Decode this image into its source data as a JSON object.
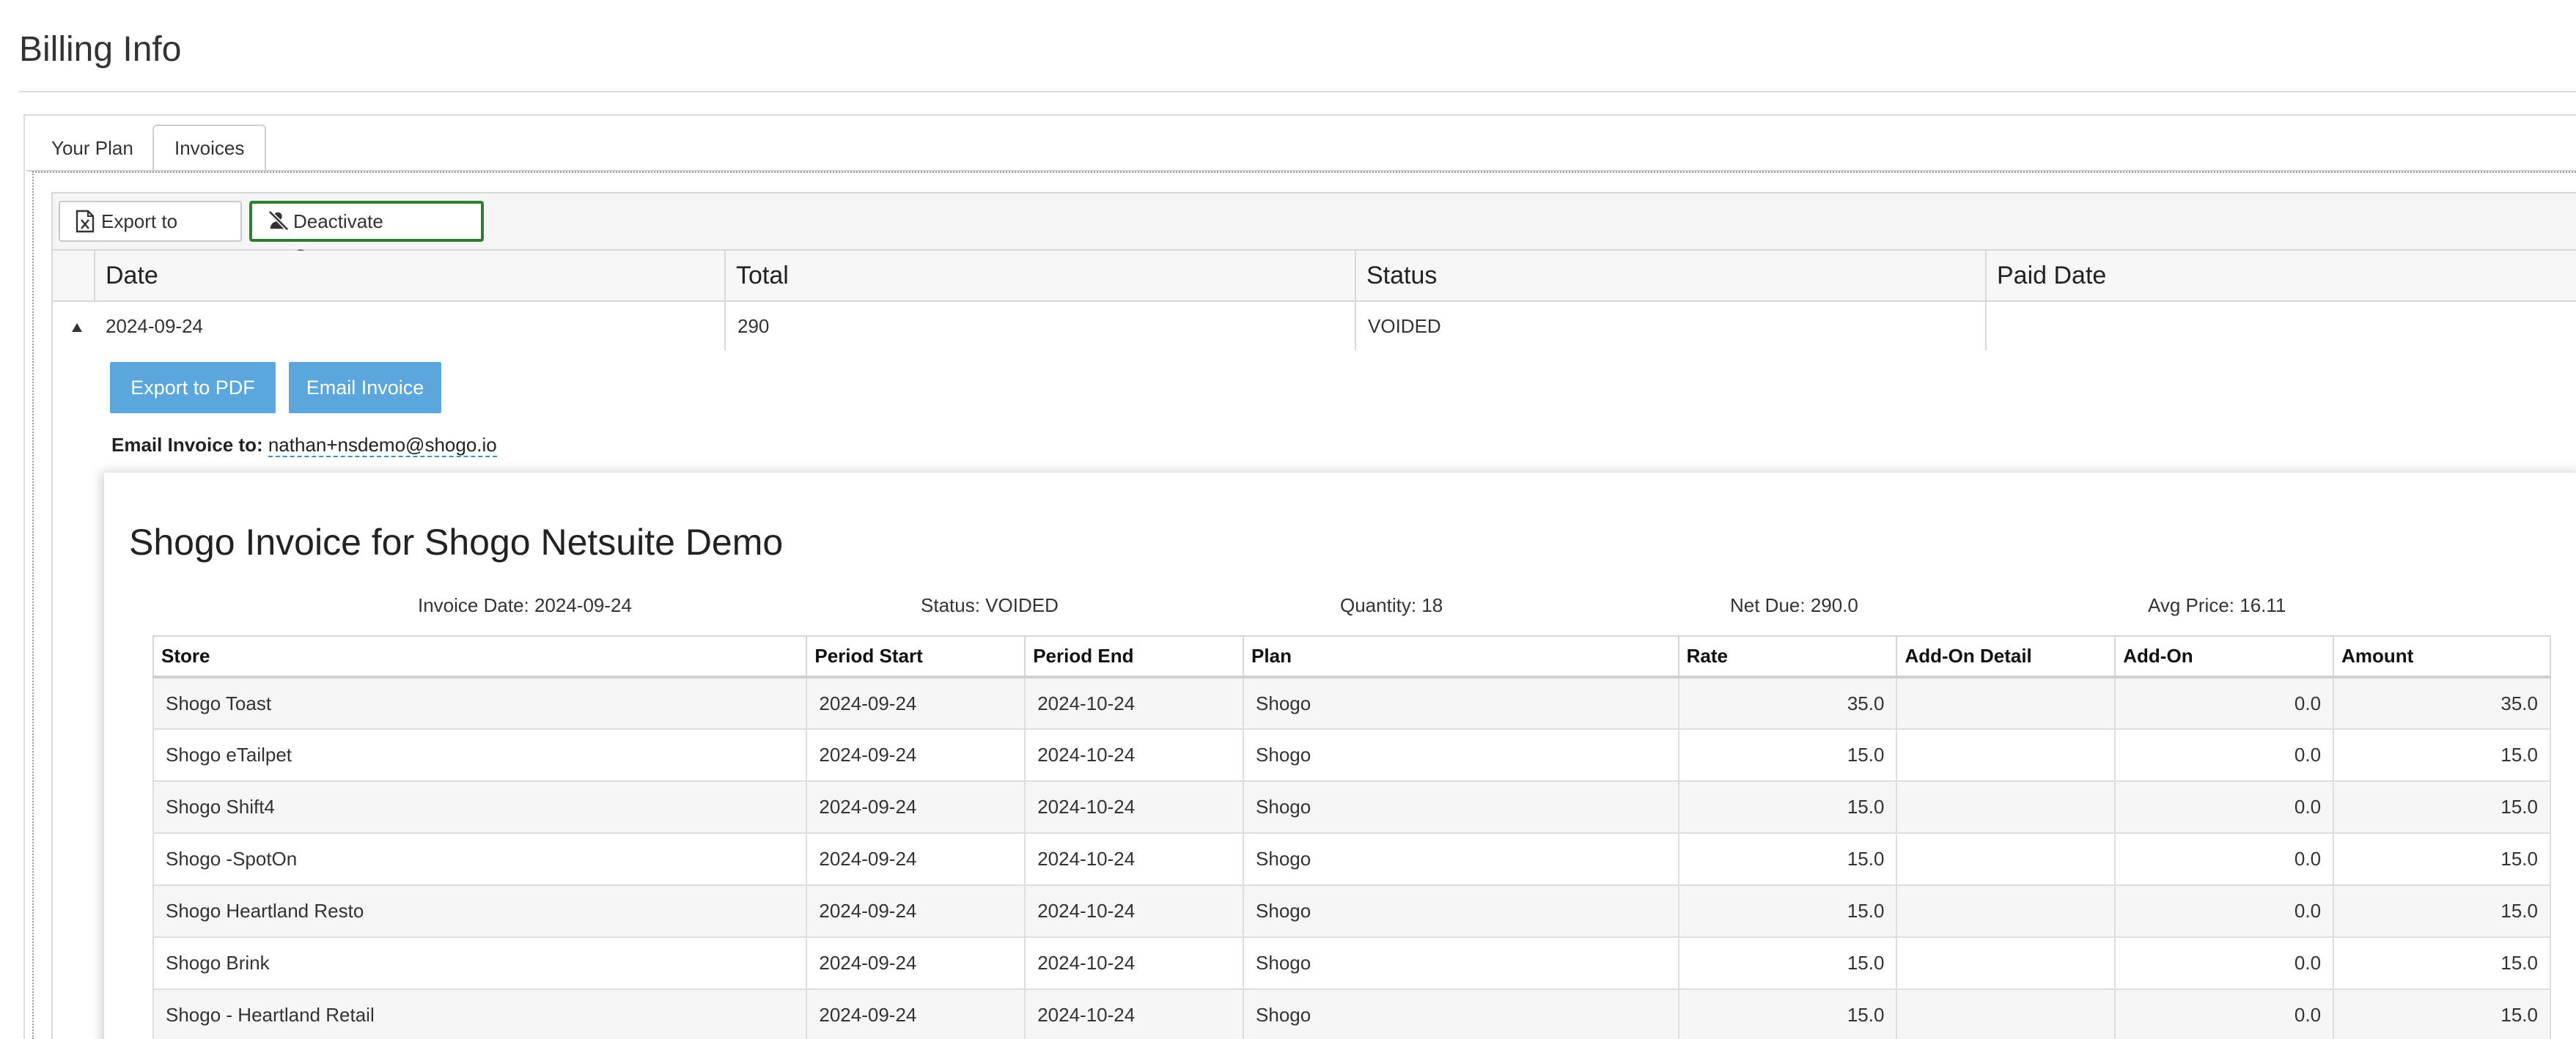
{
  "page": {
    "title": "Billing Info"
  },
  "tabs": [
    {
      "label": "Your Plan"
    },
    {
      "label": "Invoices"
    }
  ],
  "toolbar": {
    "export_excel_label": "Export to Excel",
    "deactivate_label": "Deactivate Customer"
  },
  "grid": {
    "columns": [
      "Date",
      "Total",
      "Status",
      "Paid Date"
    ],
    "row": {
      "date": "2024-09-24",
      "total": "290",
      "status": "VOIDED",
      "paid_date": ""
    }
  },
  "detail": {
    "export_pdf_label": "Export to PDF",
    "email_invoice_label": "Email Invoice",
    "email_to_label": "Email Invoice to:",
    "email_to_address": "nathan+nsdemo@shogo.io"
  },
  "invoice": {
    "title": "Shogo Invoice for Shogo Netsuite Demo",
    "meta": {
      "invoice_date": "Invoice Date: 2024-09-24",
      "status": "Status: VOIDED",
      "quantity": "Quantity: 18",
      "net_due": "Net Due: 290.0",
      "avg_price": "Avg Price: 16.11"
    },
    "columns": [
      "Store",
      "Period Start",
      "Period End",
      "Plan",
      "Rate",
      "Add-On Detail",
      "Add-On",
      "Amount"
    ],
    "rows": [
      {
        "store": "Shogo Toast",
        "start": "2024-09-24",
        "end": "2024-10-24",
        "plan": "Shogo",
        "rate": "35.0",
        "addon_detail": "",
        "addon": "0.0",
        "amount": "35.0"
      },
      {
        "store": "Shogo eTailpet",
        "start": "2024-09-24",
        "end": "2024-10-24",
        "plan": "Shogo",
        "rate": "15.0",
        "addon_detail": "",
        "addon": "0.0",
        "amount": "15.0"
      },
      {
        "store": "Shogo Shift4",
        "start": "2024-09-24",
        "end": "2024-10-24",
        "plan": "Shogo",
        "rate": "15.0",
        "addon_detail": "",
        "addon": "0.0",
        "amount": "15.0"
      },
      {
        "store": "Shogo -SpotOn",
        "start": "2024-09-24",
        "end": "2024-10-24",
        "plan": "Shogo",
        "rate": "15.0",
        "addon_detail": "",
        "addon": "0.0",
        "amount": "15.0"
      },
      {
        "store": "Shogo Heartland Resto",
        "start": "2024-09-24",
        "end": "2024-10-24",
        "plan": "Shogo",
        "rate": "15.0",
        "addon_detail": "",
        "addon": "0.0",
        "amount": "15.0"
      },
      {
        "store": "Shogo Brink",
        "start": "2024-09-24",
        "end": "2024-10-24",
        "plan": "Shogo",
        "rate": "15.0",
        "addon_detail": "",
        "addon": "0.0",
        "amount": "15.0"
      },
      {
        "store": "Shogo - Heartland Retail",
        "start": "2024-09-24",
        "end": "2024-10-24",
        "plan": "Shogo",
        "rate": "15.0",
        "addon_detail": "",
        "addon": "0.0",
        "amount": "15.0"
      }
    ]
  }
}
